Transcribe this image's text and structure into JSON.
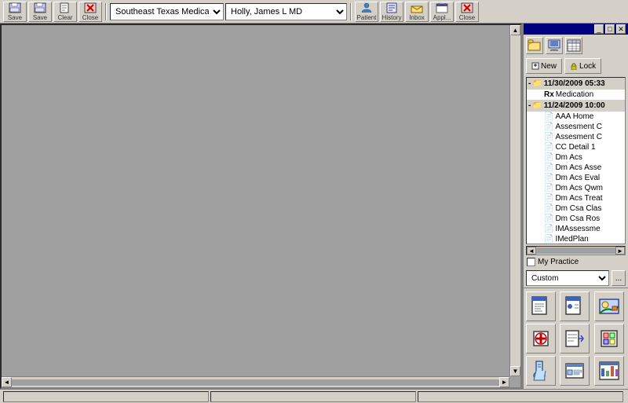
{
  "toolbar": {
    "buttons": [
      {
        "id": "save",
        "label": "Save",
        "icon": "💾"
      },
      {
        "id": "save2",
        "label": "Save",
        "icon": "💾"
      },
      {
        "id": "clear",
        "label": "Clear",
        "icon": "🗒️"
      },
      {
        "id": "close",
        "label": "Close",
        "icon": "✖"
      }
    ],
    "assoc_value": "Southeast Texas Medical Associ...",
    "provider_value": "Holly, James  L MD",
    "right_buttons": [
      {
        "id": "patient",
        "label": "Patient",
        "icon": "👤"
      },
      {
        "id": "history",
        "label": "History",
        "icon": "📋"
      },
      {
        "id": "inbox",
        "label": "Inbox",
        "icon": "📥"
      },
      {
        "id": "appt",
        "label": "Appl...",
        "icon": "📅"
      },
      {
        "id": "close2",
        "label": "Close",
        "icon": "✖"
      }
    ]
  },
  "right_panel": {
    "title": "",
    "top_icons": [
      "📁",
      "🖥️",
      "📊"
    ],
    "new_label": "New",
    "lock_label": "Lock",
    "tree": {
      "nodes": [
        {
          "date": "11/30/2009 05:33",
          "children": [
            {
              "label": "Medication",
              "icon": "Rx"
            }
          ]
        },
        {
          "date": "11/24/2009 10:00",
          "children": [
            {
              "label": "AAA Home"
            },
            {
              "label": "Assesment C"
            },
            {
              "label": "Assesment C"
            },
            {
              "label": "CC Detail 1"
            },
            {
              "label": "Dm Acs"
            },
            {
              "label": "Dm Acs Asse"
            },
            {
              "label": "Dm Acs Eval"
            },
            {
              "label": "Dm Acs Qwm"
            },
            {
              "label": "Dm Acs Treat"
            },
            {
              "label": "Dm Csa Clas"
            },
            {
              "label": "Dm Csa Ros"
            },
            {
              "label": "IMAssessme"
            },
            {
              "label": "IMedPlan"
            }
          ]
        }
      ]
    },
    "my_practice_label": "My Practice",
    "custom_label": "Custom",
    "ellipsis_label": "...",
    "bottom_icons": [
      {
        "id": "icon1",
        "symbol": "📋"
      },
      {
        "id": "icon2",
        "symbol": "📋"
      },
      {
        "id": "icon3",
        "symbol": "📷"
      },
      {
        "id": "icon4",
        "symbol": "➕"
      },
      {
        "id": "icon5",
        "symbol": "📋"
      },
      {
        "id": "icon6",
        "symbol": "🖼️"
      },
      {
        "id": "icon7",
        "symbol": "⚗️"
      },
      {
        "id": "icon8",
        "symbol": "📋"
      },
      {
        "id": "icon9",
        "symbol": "📊"
      }
    ]
  },
  "status": {
    "segments": [
      "",
      "",
      ""
    ]
  }
}
